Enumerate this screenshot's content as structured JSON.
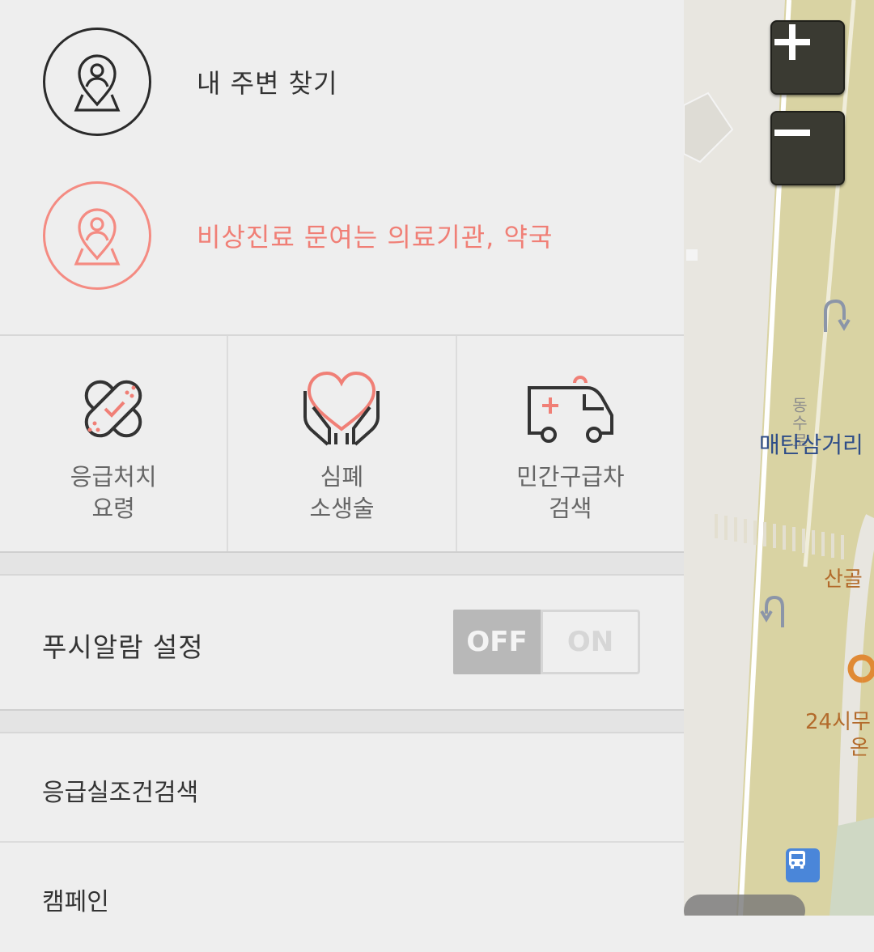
{
  "menu": {
    "nearby_label": "내 주변 찾기",
    "emergency_label": "비상진료 문여는 의료기관, 약국"
  },
  "grid": {
    "first_aid": {
      "line1": "응급처치",
      "line2": "요령"
    },
    "cpr": {
      "line1": "심폐",
      "line2": "소생술"
    },
    "ambulance": {
      "line1": "민간구급차",
      "line2": "검색"
    }
  },
  "push": {
    "label": "푸시알람 설정",
    "off_label": "OFF",
    "on_label": "ON",
    "state": "OFF"
  },
  "list": {
    "condition_search": "응급실조건검색",
    "campaign": "캠페인"
  },
  "map": {
    "junction_label": "매탄삼거리",
    "road_label": "동수로",
    "place_label": "산골",
    "store_line1": "24시무",
    "store_line2": "온"
  },
  "colors": {
    "accent": "#f07f76",
    "panel_bg": "#eeeeee",
    "map_bg": "#d9d3a3",
    "zoom_bg": "#3a3a32"
  }
}
